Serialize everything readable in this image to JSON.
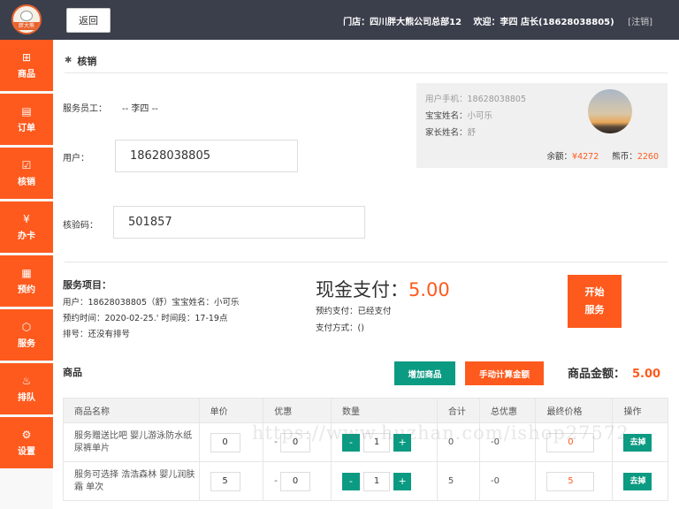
{
  "header": {
    "logo_text": "胖大熊",
    "back_label": "返回",
    "store_info": "门店：四川胖大熊公司总部12",
    "welcome": "欢迎：李四 店长(18628038805)",
    "logout": "[注销]"
  },
  "sidebar": {
    "items": [
      {
        "label": "商品",
        "icon": "grid-plus-icon",
        "glyph": "⊞"
      },
      {
        "label": "订单",
        "icon": "clipboard-icon",
        "glyph": "▤"
      },
      {
        "label": "核销",
        "icon": "check-doc-icon",
        "glyph": "☑"
      },
      {
        "label": "办卡",
        "icon": "yen-coin-icon",
        "glyph": "¥"
      },
      {
        "label": "预约",
        "icon": "calendar-icon",
        "glyph": "▦"
      },
      {
        "label": "服务",
        "icon": "box-icon",
        "glyph": "⬡"
      },
      {
        "label": "排队",
        "icon": "flame-icon",
        "glyph": "♨"
      },
      {
        "label": "设置",
        "icon": "gear-icon",
        "glyph": "⚙"
      }
    ]
  },
  "section": {
    "title": "核销"
  },
  "form": {
    "staff_label": "服务员工：",
    "staff_value": "-- 李四 --",
    "user_label": "用户：",
    "user_value": "18628038805",
    "code_label": "核验码：",
    "code_value": "501857"
  },
  "userbox": {
    "phone_label": "用户手机：",
    "phone": "18628038805",
    "baby_label": "宝宝姓名：",
    "baby": "小可乐",
    "parent_label": "家长姓名：",
    "parent": "舒",
    "balance_label": "余额：",
    "balance": "¥4272",
    "coins_label": "熊币：",
    "coins": "2260"
  },
  "service": {
    "title": "服务项目：",
    "user_line": "用户：18628038805（舒）宝宝姓名：小可乐",
    "time_line": "预约时间：2020-02-25.' 时间段：17-19点",
    "queue_line": "排号：还没有排号"
  },
  "payment": {
    "label": "现金支付：",
    "amount": "5.00",
    "prepay": "预约支付：已经支付",
    "method": "支付方式：()"
  },
  "start_button": "开始服务",
  "goods": {
    "title": "商品",
    "add_label": "增加商品",
    "calc_label": "手动计算金额",
    "amount_label": "商品金额：",
    "amount": "5.00"
  },
  "table": {
    "headers": [
      "商品名称",
      "单价",
      "优惠",
      "数量",
      "合计",
      "总优惠",
      "最终价格",
      "操作"
    ],
    "rows": [
      {
        "name": "服务赠送比吧 婴儿游泳防水纸尿裤单片",
        "price": "0",
        "discount": "0",
        "qty": "1",
        "total": "0",
        "total_discount": "-0",
        "final": "0",
        "action": "去掉"
      },
      {
        "name": "服务可选择 浩浩森林 婴儿润肤霜 单次",
        "price": "5",
        "discount": "0",
        "qty": "1",
        "total": "5",
        "total_discount": "-0",
        "final": "5",
        "action": "去掉"
      }
    ]
  },
  "watermark": "https://www.huzhan.com/ishop27572",
  "colors": {
    "accent": "#fe5a1d",
    "teal": "#0b9a82",
    "topbar": "#3b3f4c"
  }
}
